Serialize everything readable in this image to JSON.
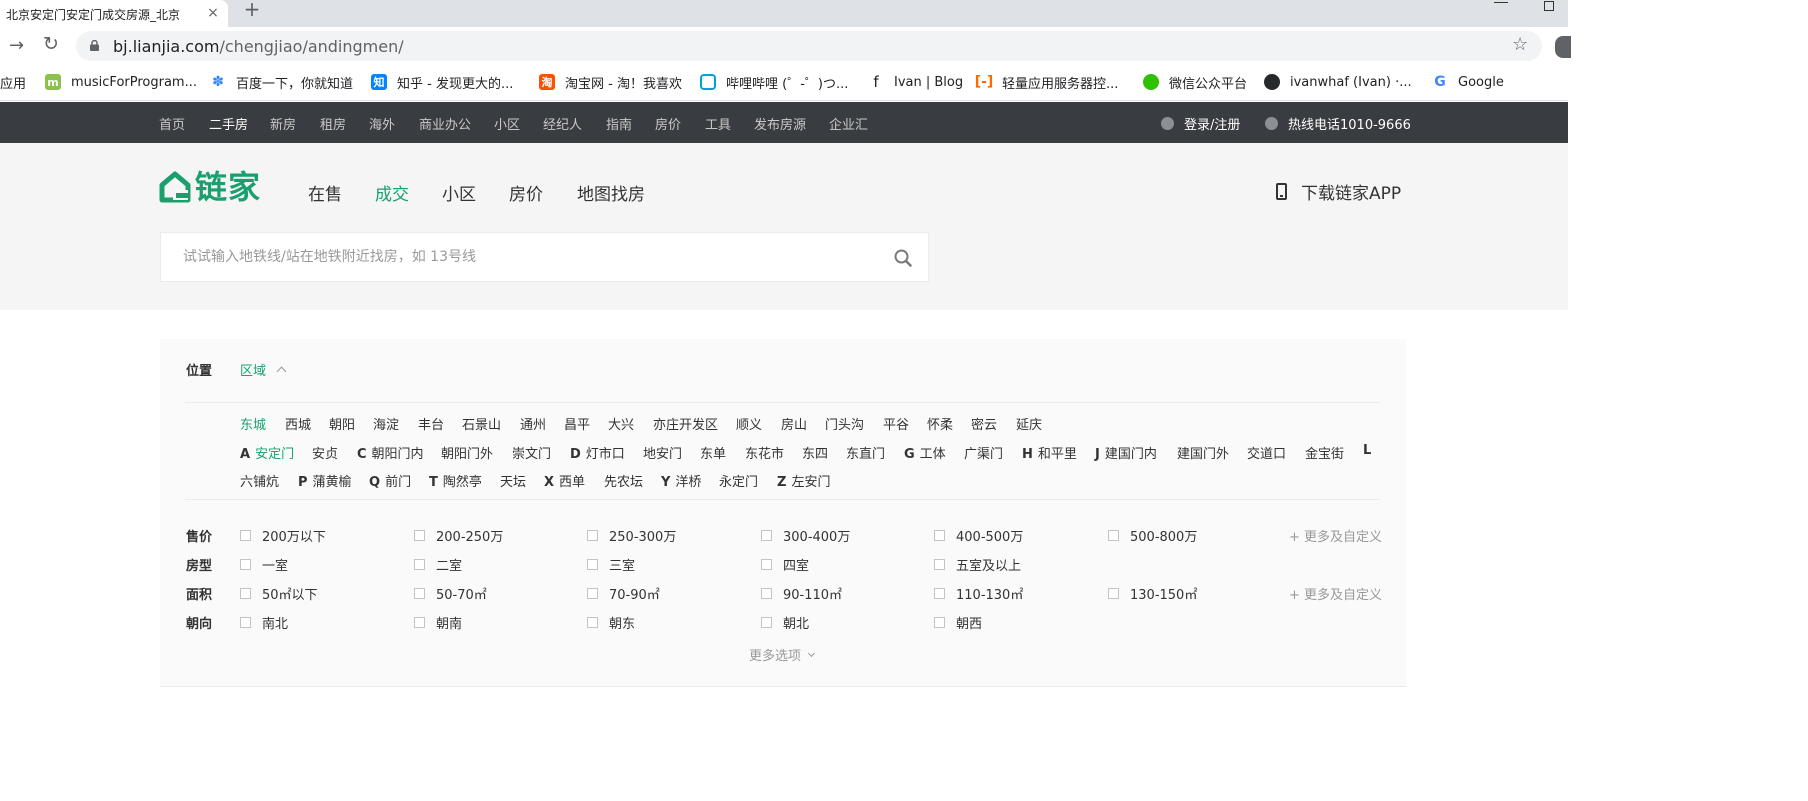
{
  "browser": {
    "tab_title": "北京安定门安定门成交房源_北京",
    "tab_close": "×",
    "new_tab": "+",
    "url_host": "bj.lianjia.com",
    "url_path": "/chengjiao/andingmen/",
    "nav_forward": "→",
    "nav_reload": "↻",
    "star": "☆",
    "bookmarks": [
      {
        "label": "应用",
        "icon": "apps-icon",
        "color": ""
      },
      {
        "label": "musicForProgram...",
        "icon": "m-icon",
        "color": "#8bc34a"
      },
      {
        "label": "百度一下，你就知道",
        "icon": "baidu-paw-icon",
        "color": "#3385ff"
      },
      {
        "label": "知乎 - 发现更大的...",
        "icon": "zhihu-icon",
        "color": "#0084ff"
      },
      {
        "label": "淘宝网 - 淘！我喜欢",
        "icon": "taobao-icon",
        "color": "#ff5000"
      },
      {
        "label": "哔哩哔哩 (゜-゜)つ...",
        "icon": "bilibili-icon",
        "color": "#00a1d6"
      },
      {
        "label": "Ivan | Blog",
        "icon": "f-icon",
        "color": ""
      },
      {
        "label": "轻量应用服务器控...",
        "icon": "aliyun-icon",
        "color": "#ff6a00"
      },
      {
        "label": "微信公众平台",
        "icon": "wechat-icon",
        "color": "#2dc100"
      },
      {
        "label": "ivanwhaf (Ivan) ·...",
        "icon": "github-icon",
        "color": "#24292e"
      },
      {
        "label": "Google",
        "icon": "google-icon",
        "color": "#4285f4"
      }
    ]
  },
  "site_nav": {
    "items": [
      "首页",
      "二手房",
      "新房",
      "租房",
      "海外",
      "商业办公",
      "小区",
      "经纪人",
      "指南",
      "房价",
      "工具",
      "发布房源",
      "企业汇"
    ],
    "active_index": 1,
    "login": "登录/注册",
    "hotline": "热线电话1010-9666"
  },
  "header": {
    "logo_text": "链家",
    "main_nav": [
      "在售",
      "成交",
      "小区",
      "房价",
      "地图找房"
    ],
    "active_index": 1,
    "app_download": "下载链家APP",
    "search_placeholder": "试试输入地铁线/站在地铁附近找房，如 13号线"
  },
  "filter": {
    "position_label": "位置",
    "region_toggle": "区域",
    "districts": [
      "东城",
      "西城",
      "朝阳",
      "海淀",
      "丰台",
      "石景山",
      "通州",
      "昌平",
      "大兴",
      "亦庄开发区",
      "顺义",
      "房山",
      "门头沟",
      "平谷",
      "怀柔",
      "密云",
      "延庆"
    ],
    "active_district": 0,
    "subareas_row1": [
      {
        "letter": "A",
        "name": "安定门",
        "active": true
      },
      {
        "letter": "",
        "name": "安贞",
        "active": false
      },
      {
        "letter": "C",
        "name": "朝阳门内",
        "active": false
      },
      {
        "letter": "",
        "name": "朝阳门外",
        "active": false
      },
      {
        "letter": "",
        "name": "崇文门",
        "active": false
      },
      {
        "letter": "D",
        "name": "灯市口",
        "active": false
      },
      {
        "letter": "",
        "name": "地安门",
        "active": false
      },
      {
        "letter": "",
        "name": "东单",
        "active": false
      },
      {
        "letter": "",
        "name": "东花市",
        "active": false
      },
      {
        "letter": "",
        "name": "东四",
        "active": false
      },
      {
        "letter": "",
        "name": "东直门",
        "active": false
      },
      {
        "letter": "G",
        "name": "工体",
        "active": false
      },
      {
        "letter": "",
        "name": "广渠门",
        "active": false
      },
      {
        "letter": "H",
        "name": "和平里",
        "active": false
      },
      {
        "letter": "J",
        "name": "建国门内",
        "active": false
      },
      {
        "letter": "",
        "name": "建国门外",
        "active": false
      },
      {
        "letter": "",
        "name": "交道口",
        "active": false
      },
      {
        "letter": "",
        "name": "金宝街",
        "active": false
      },
      {
        "letter": "L",
        "name": "",
        "active": false
      }
    ],
    "subareas_row2": [
      {
        "letter": "",
        "name": "六铺炕",
        "active": false
      },
      {
        "letter": "P",
        "name": "蒲黄榆",
        "active": false
      },
      {
        "letter": "Q",
        "name": "前门",
        "active": false
      },
      {
        "letter": "T",
        "name": "陶然亭",
        "active": false
      },
      {
        "letter": "",
        "name": "天坛",
        "active": false
      },
      {
        "letter": "X",
        "name": "西单",
        "active": false
      },
      {
        "letter": "",
        "name": "先农坛",
        "active": false
      },
      {
        "letter": "Y",
        "name": "洋桥",
        "active": false
      },
      {
        "letter": "",
        "name": "永定门",
        "active": false
      },
      {
        "letter": "Z",
        "name": "左安门",
        "active": false
      }
    ],
    "price_label": "售价",
    "price_options": [
      "200万以下",
      "200-250万",
      "250-300万",
      "300-400万",
      "400-500万",
      "500-800万"
    ],
    "room_label": "房型",
    "room_options": [
      "一室",
      "二室",
      "三室",
      "四室",
      "五室及以上"
    ],
    "area_label": "面积",
    "area_options": [
      "50㎡以下",
      "50-70㎡",
      "70-90㎡",
      "90-110㎡",
      "110-130㎡",
      "130-150㎡"
    ],
    "orient_label": "朝向",
    "orient_options": [
      "南北",
      "朝南",
      "朝东",
      "朝北",
      "朝西"
    ],
    "custom_link": "+ 更多及自定义",
    "more_options": "更多选项"
  }
}
